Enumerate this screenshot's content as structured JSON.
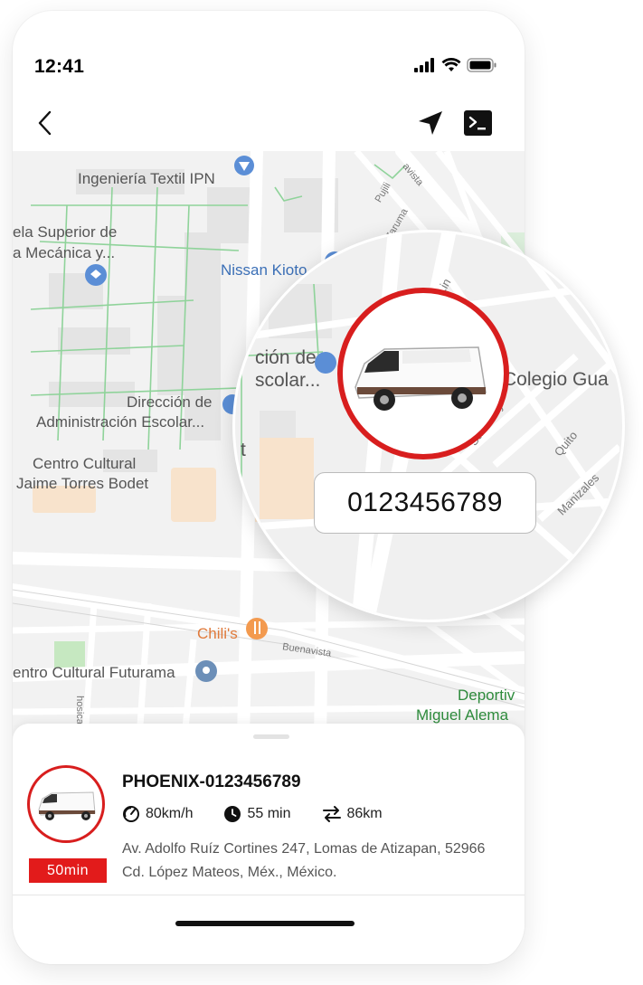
{
  "status_bar": {
    "time": "12:41"
  },
  "map": {
    "labels": {
      "ingenieria": "Ingeniería Textil IPN",
      "escuela1": "ela Superior de",
      "escuela2": "a Mecánica y...",
      "nissan": "Nissan Kioto",
      "direccion1": "Dirección de",
      "direccion2": "Administración Escolar...",
      "centro1": "Centro Cultural",
      "centro2": "Jaime Torres Bodet",
      "chilis": "Chili's",
      "futurama": "entro Cultural Futurama",
      "deportivo1": "Deportiv",
      "deportivo2": "Miguel Alema"
    },
    "streets": {
      "buenavista": "Buenavista",
      "pujili": "Pujili",
      "zaruma": "Zaruma",
      "avista": "avista",
      "hosica": "hosica"
    }
  },
  "magnifier": {
    "labels": {
      "direccion1": "ción de",
      "direccion2": "scolar...",
      "colegio": "Colegio Gua",
      "quito": "Quito",
      "manizales": "Manizales",
      "salaverry": "Salaverry",
      "lin": "Lin",
      "t": "t"
    },
    "phone_number": "0123456789"
  },
  "vehicle": {
    "name": "PHOENIX-0123456789",
    "eta_badge": "50min",
    "speed": "80km/h",
    "time": "55 min",
    "distance": "86km",
    "address": "Av. Adolfo Ruíz Cortines 247, Lomas de Atizapan, 52966 Cd. López Mateos, Méx., México."
  },
  "colors": {
    "accent_red": "#d81e1e",
    "badge_red": "#e21b1b",
    "map_bg": "#f2f2f2",
    "green_path": "#8fd39a"
  },
  "icons": [
    "back-chevron-icon",
    "location-arrow-icon",
    "terminal-icon",
    "speedometer-icon",
    "clock-icon",
    "route-icon",
    "cellular-icon",
    "wifi-icon",
    "battery-icon",
    "van-icon"
  ]
}
